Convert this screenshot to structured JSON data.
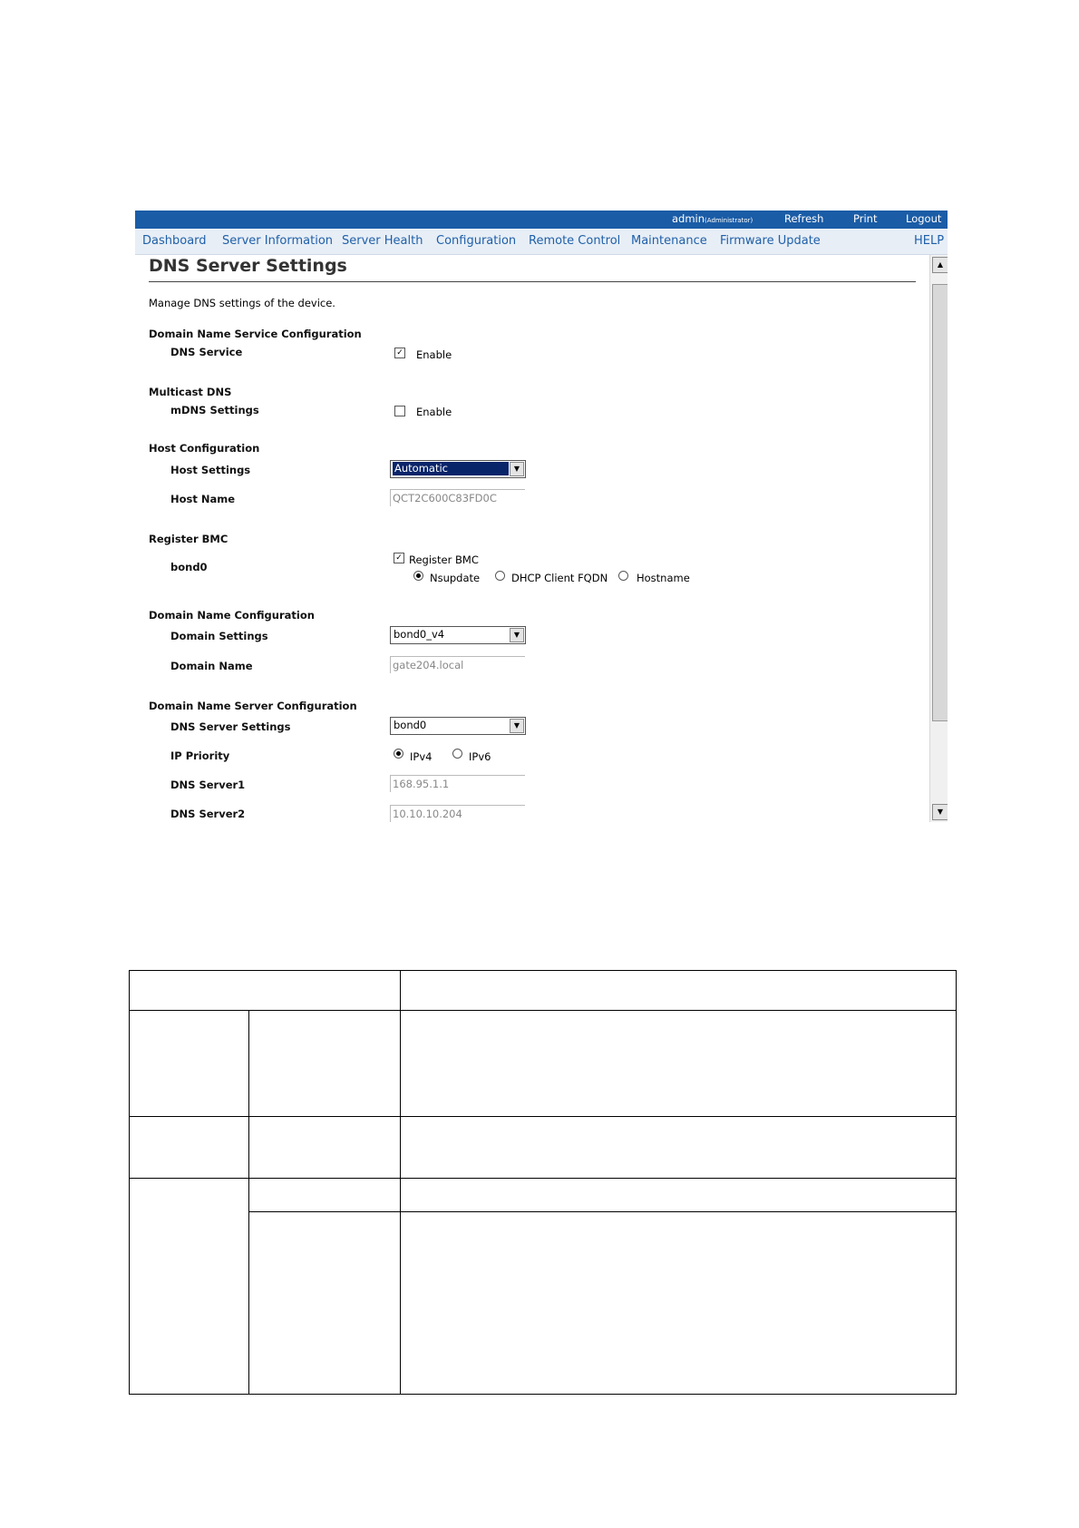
{
  "topbar": {
    "user": "admin",
    "role": "(Administrator)",
    "refresh": "Refresh",
    "print": "Print",
    "logout": "Logout"
  },
  "nav": {
    "items": [
      "Dashboard",
      "Server Information",
      "Server Health",
      "Configuration",
      "Remote Control",
      "Maintenance",
      "Firmware Update"
    ],
    "help": "HELP"
  },
  "page": {
    "title": "DNS Server Settings",
    "description": "Manage DNS settings of the device."
  },
  "dns_config": {
    "section": "Domain Name Service Configuration",
    "label": "DNS Service",
    "checked": true,
    "option": "Enable"
  },
  "mdns": {
    "section": "Multicast DNS",
    "label": "mDNS Settings",
    "checked": false,
    "option": "Enable"
  },
  "host": {
    "section": "Host Configuration",
    "settings_label": "Host Settings",
    "settings_value": "Automatic",
    "name_label": "Host Name",
    "name_value": "QCT2C600C83FD0C"
  },
  "register": {
    "section": "Register BMC",
    "label": "bond0",
    "checkbox_label": "Register BMC",
    "checked": true,
    "options": [
      "Nsupdate",
      "DHCP Client FQDN",
      "Hostname"
    ],
    "selected": "Nsupdate"
  },
  "domain": {
    "section": "Domain Name Configuration",
    "settings_label": "Domain Settings",
    "settings_value": "bond0_v4",
    "name_label": "Domain Name",
    "name_value": "gate204.local"
  },
  "dns_server": {
    "section": "Domain Name Server Configuration",
    "settings_label": "DNS Server Settings",
    "settings_value": "bond0",
    "priority_label": "IP Priority",
    "priority_options": [
      "IPv4",
      "IPv6"
    ],
    "priority_selected": "IPv4",
    "server1_label": "DNS Server1",
    "server1_value": "168.95.1.1",
    "server2_label": "DNS Server2",
    "server2_value": "10.10.10.204"
  },
  "colors": {
    "topbar": "#1a5ca6",
    "nav_text": "#1f5fa8",
    "nav_bg": "#e7eef6",
    "selection": "#0a246a"
  }
}
